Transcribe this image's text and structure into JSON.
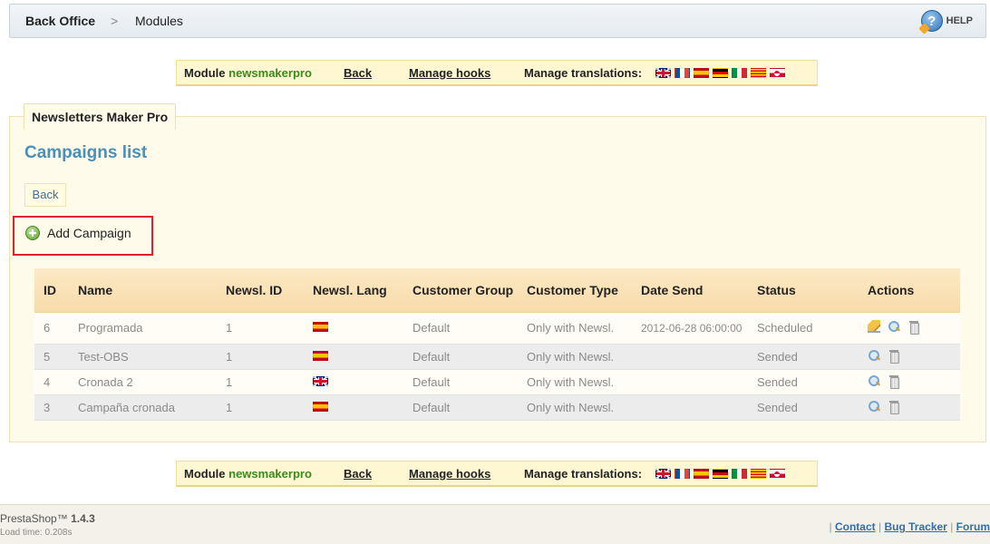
{
  "header": {
    "breadcrumb_root": "Back Office",
    "breadcrumb_sep": ">",
    "breadcrumb_current": "Modules",
    "help_label": "HELP"
  },
  "module_bar": {
    "module_prefix": "Module",
    "module_name": "newsmakerpro",
    "back_label": "Back",
    "hooks_label": "Manage hooks",
    "translations_label": "Manage translations:",
    "flags": [
      "gb-flag-icon",
      "fr-flag-icon",
      "es-flag-icon",
      "de-flag-icon",
      "it-flag-icon",
      "ca-flag-icon",
      "gl-flag-icon"
    ]
  },
  "panel": {
    "legend": "Newsletters Maker Pro",
    "title": "Campaigns list",
    "back_button": "Back",
    "add_campaign": "Add Campaign"
  },
  "table": {
    "columns": [
      "ID",
      "Name",
      "Newsl. ID",
      "Newsl. Lang",
      "Customer Group",
      "Customer Type",
      "Date Send",
      "Status",
      "Actions"
    ],
    "rows": [
      {
        "id": "6",
        "name": "Programada",
        "newsl_id": "1",
        "lang_flag": "es-flag-icon",
        "group": "Default",
        "type": "Only with Newsl.",
        "date": "2012-06-28 06:00:00",
        "status": "Scheduled"
      },
      {
        "id": "5",
        "name": "Test-OBS",
        "newsl_id": "1",
        "lang_flag": "es-flag-icon",
        "group": "Default",
        "type": "Only with Newsl.",
        "date": "",
        "status": "Sended"
      },
      {
        "id": "4",
        "name": "Cronada 2",
        "newsl_id": "1",
        "lang_flag": "gb-flag-icon",
        "group": "Default",
        "type": "Only with Newsl.",
        "date": "",
        "status": "Sended"
      },
      {
        "id": "3",
        "name": "Campaña cronada",
        "newsl_id": "1",
        "lang_flag": "es-flag-icon",
        "group": "Default",
        "type": "Only with Newsl.",
        "date": "",
        "status": "Sended"
      }
    ]
  },
  "footer": {
    "version_name": "PrestaShop™",
    "version_number": "1.4.3",
    "load_time": "Load time: 0.208s",
    "sep": "|",
    "contact": "Contact",
    "bug_tracker": "Bug Tracker",
    "forum": "Forum"
  },
  "colors": {
    "accent_title": "#4a90b8",
    "module_name": "#3a8a1c",
    "highlight_border": "#e0202a"
  }
}
